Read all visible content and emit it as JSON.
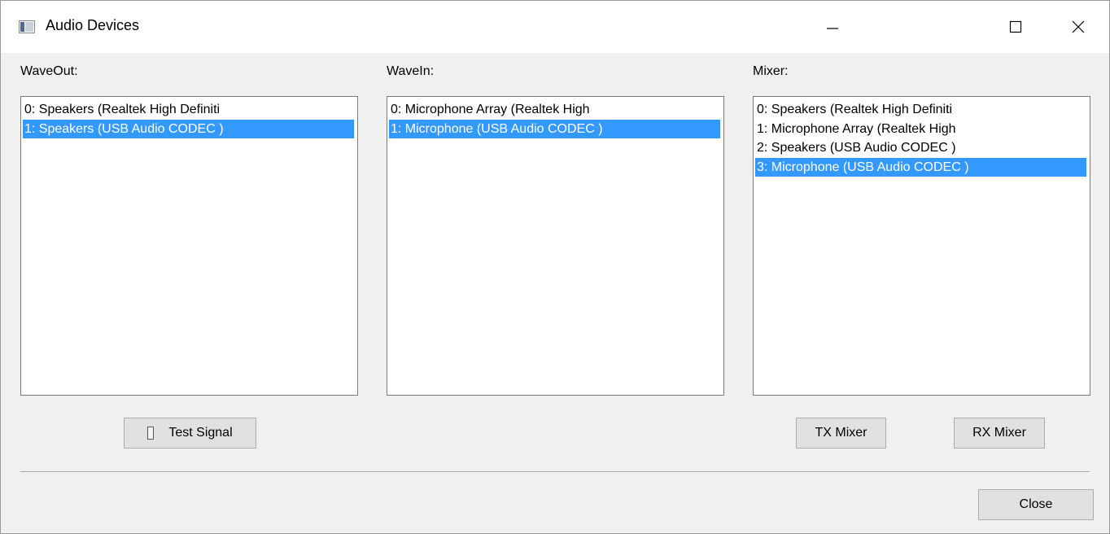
{
  "window": {
    "title": "Audio Devices"
  },
  "panels": {
    "waveout": {
      "label": "WaveOut:",
      "items": [
        {
          "text": "0: Speakers (Realtek High Definiti",
          "selected": false
        },
        {
          "text": "1: Speakers (USB Audio CODEC )",
          "selected": true
        }
      ]
    },
    "wavein": {
      "label": "WaveIn:",
      "items": [
        {
          "text": "0: Microphone Array (Realtek High",
          "selected": false
        },
        {
          "text": "1: Microphone (USB Audio CODEC )",
          "selected": true
        }
      ]
    },
    "mixer": {
      "label": "Mixer:",
      "items": [
        {
          "text": "0: Speakers (Realtek High Definiti",
          "selected": false
        },
        {
          "text": "1: Microphone Array (Realtek High",
          "selected": false
        },
        {
          "text": "2: Speakers (USB Audio CODEC )",
          "selected": false
        },
        {
          "text": "3: Microphone (USB Audio CODEC )",
          "selected": true
        }
      ]
    }
  },
  "buttons": {
    "test_signal": "Test Signal",
    "tx_mixer": "TX Mixer",
    "rx_mixer": "RX Mixer",
    "close": "Close"
  },
  "colors": {
    "selection": "#3399ff",
    "window_bg": "#f0f0f0"
  }
}
